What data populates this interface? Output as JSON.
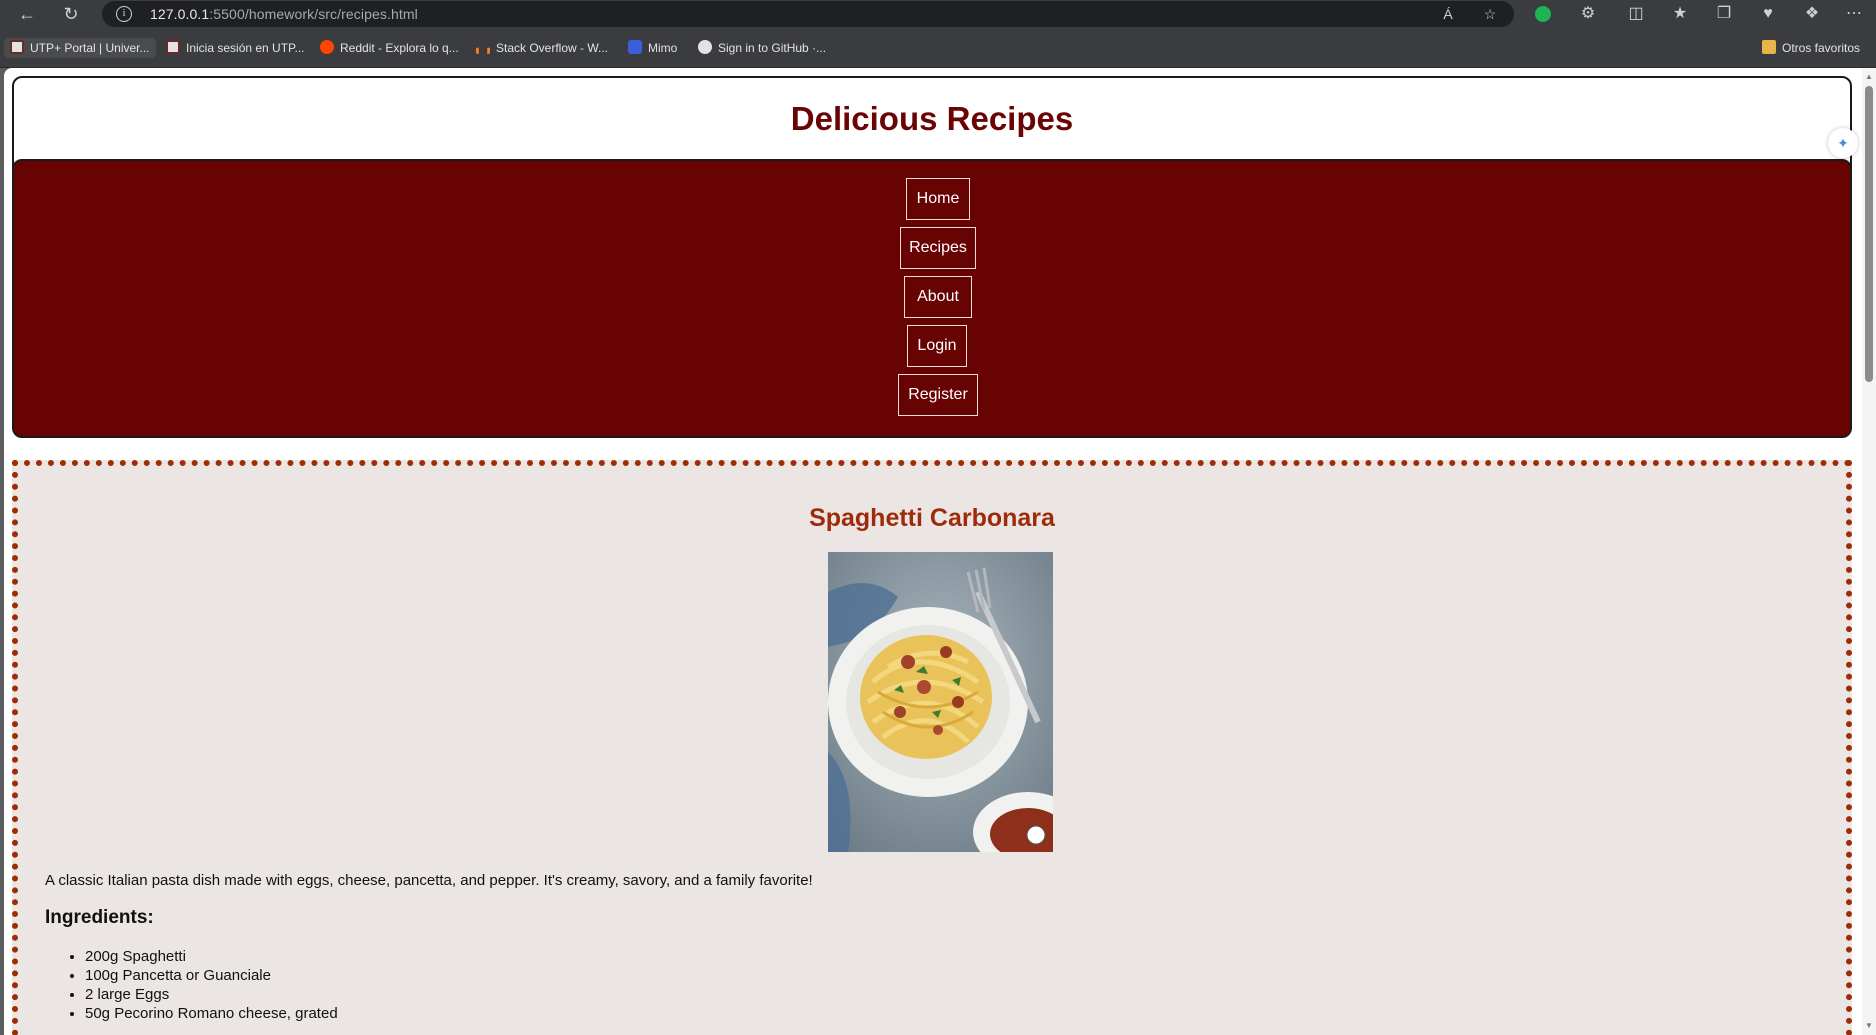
{
  "browser": {
    "url_host": "127.0.0.1",
    "url_path": ":5500/homework/src/recipes.html",
    "bookmarks": [
      {
        "label": "UTP+ Portal | Univer..."
      },
      {
        "label": "Inicia sesión en UTP..."
      },
      {
        "label": "Reddit - Explora lo q..."
      },
      {
        "label": "Stack Overflow - W..."
      },
      {
        "label": "Mimo"
      },
      {
        "label": "Sign in to GitHub ·..."
      }
    ],
    "other_favorites": "Otros favoritos"
  },
  "site": {
    "title": "Delicious Recipes",
    "nav": [
      "Home",
      "Recipes",
      "About",
      "Login",
      "Register"
    ]
  },
  "recipe": {
    "title": "Spaghetti Carbonara",
    "description": "A classic Italian pasta dish made with eggs, cheese, pancetta, and pepper. It's creamy, savory, and a family favorite!",
    "ingredients_heading": "Ingredients:",
    "ingredients": [
      "200g Spaghetti",
      "100g Pancetta or Guanciale",
      "2 large Eggs",
      "50g Pecorino Romano cheese, grated"
    ]
  },
  "colors": {
    "brand": "#680303",
    "accent": "#9e2c06",
    "section_bg": "#ebe6e4"
  }
}
